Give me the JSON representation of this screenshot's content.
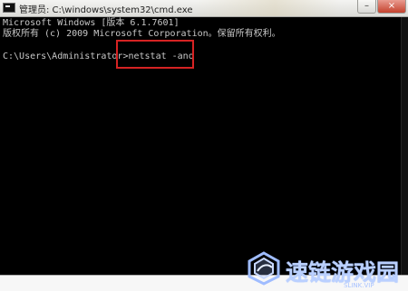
{
  "window": {
    "title": "管理员: C:\\windows\\system32\\cmd.exe",
    "buttons": {
      "minimize": "–",
      "close": "×"
    }
  },
  "console": {
    "lines": [
      "Microsoft Windows [版本 6.1.7601]",
      "版权所有 (c) 2009 Microsoft Corporation。保留所有权利。",
      "",
      "C:\\Users\\Administrator>netstat -ano"
    ],
    "highlighted_command": "netstat -ano"
  },
  "watermark": {
    "brand": "速链游戏园",
    "domain": "SLINK.VIP",
    "brand_color": "#bad0ff"
  },
  "colors": {
    "console_background": "#000000",
    "console_text": "#c8c8c8",
    "highlight_border": "#d62323"
  }
}
